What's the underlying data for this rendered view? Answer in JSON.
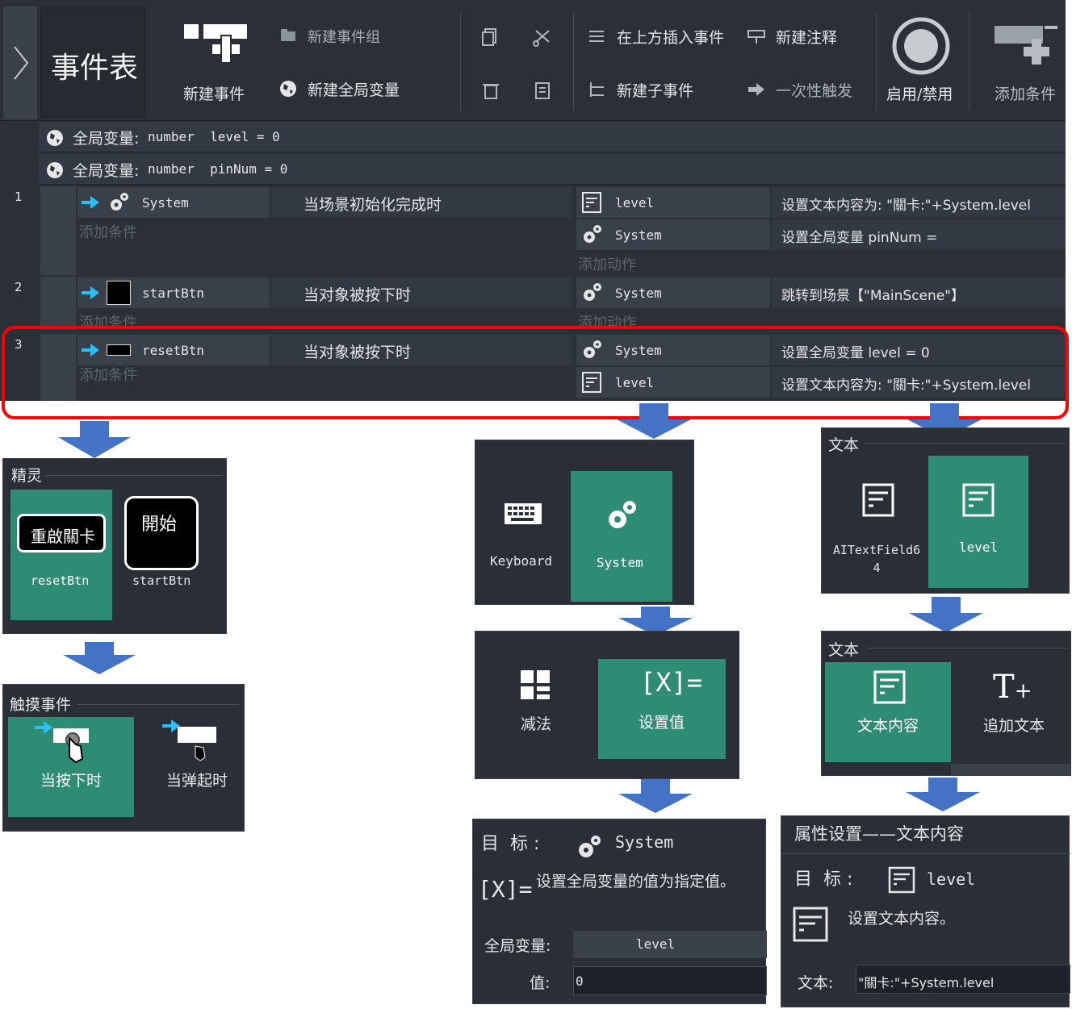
{
  "toolbar": {
    "title": "事件表",
    "new_event": "新建事件",
    "new_event_group": "新建事件组",
    "new_global_var": "新建全局变量",
    "insert_above": "在上方插入事件",
    "new_comment": "新建注释",
    "new_sub_event": "新建子事件",
    "trigger_once": "一次性触发",
    "enable_disable": "启用/禁用",
    "add_condition": "添加条件"
  },
  "globals": [
    {
      "label": "全局变量:",
      "decl": "number  level = 0"
    },
    {
      "label": "全局变量:",
      "decl": "number  pinNum = 0"
    }
  ],
  "events": [
    {
      "num": "1",
      "object": "System",
      "condition": "当场景初始化完成时",
      "add_condition": "添加条件",
      "actions": [
        {
          "object": "level",
          "text": "设置文本内容为: \"關卡:\"+System.level"
        },
        {
          "object": "System",
          "text": "设置全局变量 pinNum ="
        }
      ],
      "add_action": "添加动作"
    },
    {
      "num": "2",
      "object": "startBtn",
      "condition": "当对象被按下时",
      "add_condition": "添加条件",
      "actions": [
        {
          "object": "System",
          "text": "跳转到场景【\"MainScene\"】"
        }
      ],
      "add_action": "添加动作"
    },
    {
      "num": "3",
      "object": "resetBtn",
      "condition": "当对象被按下时",
      "add_condition": "添加条件",
      "actions": [
        {
          "object": "System",
          "text": "设置全局变量 level = 0"
        },
        {
          "object": "level",
          "text": "设置文本内容为: \"關卡:\"+System.level"
        }
      ]
    }
  ],
  "sprite_panel": {
    "title": "精灵",
    "items": [
      {
        "name": "resetBtn",
        "thumb_text": "重啟關卡"
      },
      {
        "name": "startBtn",
        "thumb_text": "開始"
      }
    ]
  },
  "touch_panel": {
    "title": "触摸事件",
    "items": [
      {
        "label": "当按下时"
      },
      {
        "label": "当弹起时"
      }
    ]
  },
  "object_panel": {
    "items": [
      {
        "label": "Keyboard"
      },
      {
        "label": "System"
      }
    ]
  },
  "system_action_panel": {
    "items": [
      {
        "label": "减法"
      },
      {
        "label": "设置值"
      }
    ]
  },
  "system_prop_panel": {
    "target_label": "目  标 :",
    "target": "System",
    "description": "设置全局变量的值为指定值。",
    "var_label": "全局变量:",
    "var_value": "level",
    "value_label": "值:",
    "value": "0"
  },
  "text_object_panel": {
    "title": "文本",
    "items": [
      {
        "label": "AITextField64"
      },
      {
        "label": "level"
      }
    ]
  },
  "text_action_panel": {
    "title": "文本",
    "items": [
      {
        "label": "文本内容"
      },
      {
        "label": "追加文本"
      }
    ]
  },
  "text_prop_panel": {
    "title": "属性设置——文本内容",
    "target_label": "目  标 :",
    "target": "level",
    "description": "设置文本内容。",
    "text_label": "文本:",
    "text_value": "\"關卡:\"+System.level"
  },
  "colors": {
    "accent": "#2e8b74",
    "highlight": "#ff0000",
    "arrow": "#4472c4",
    "bg": "#2b3038"
  }
}
